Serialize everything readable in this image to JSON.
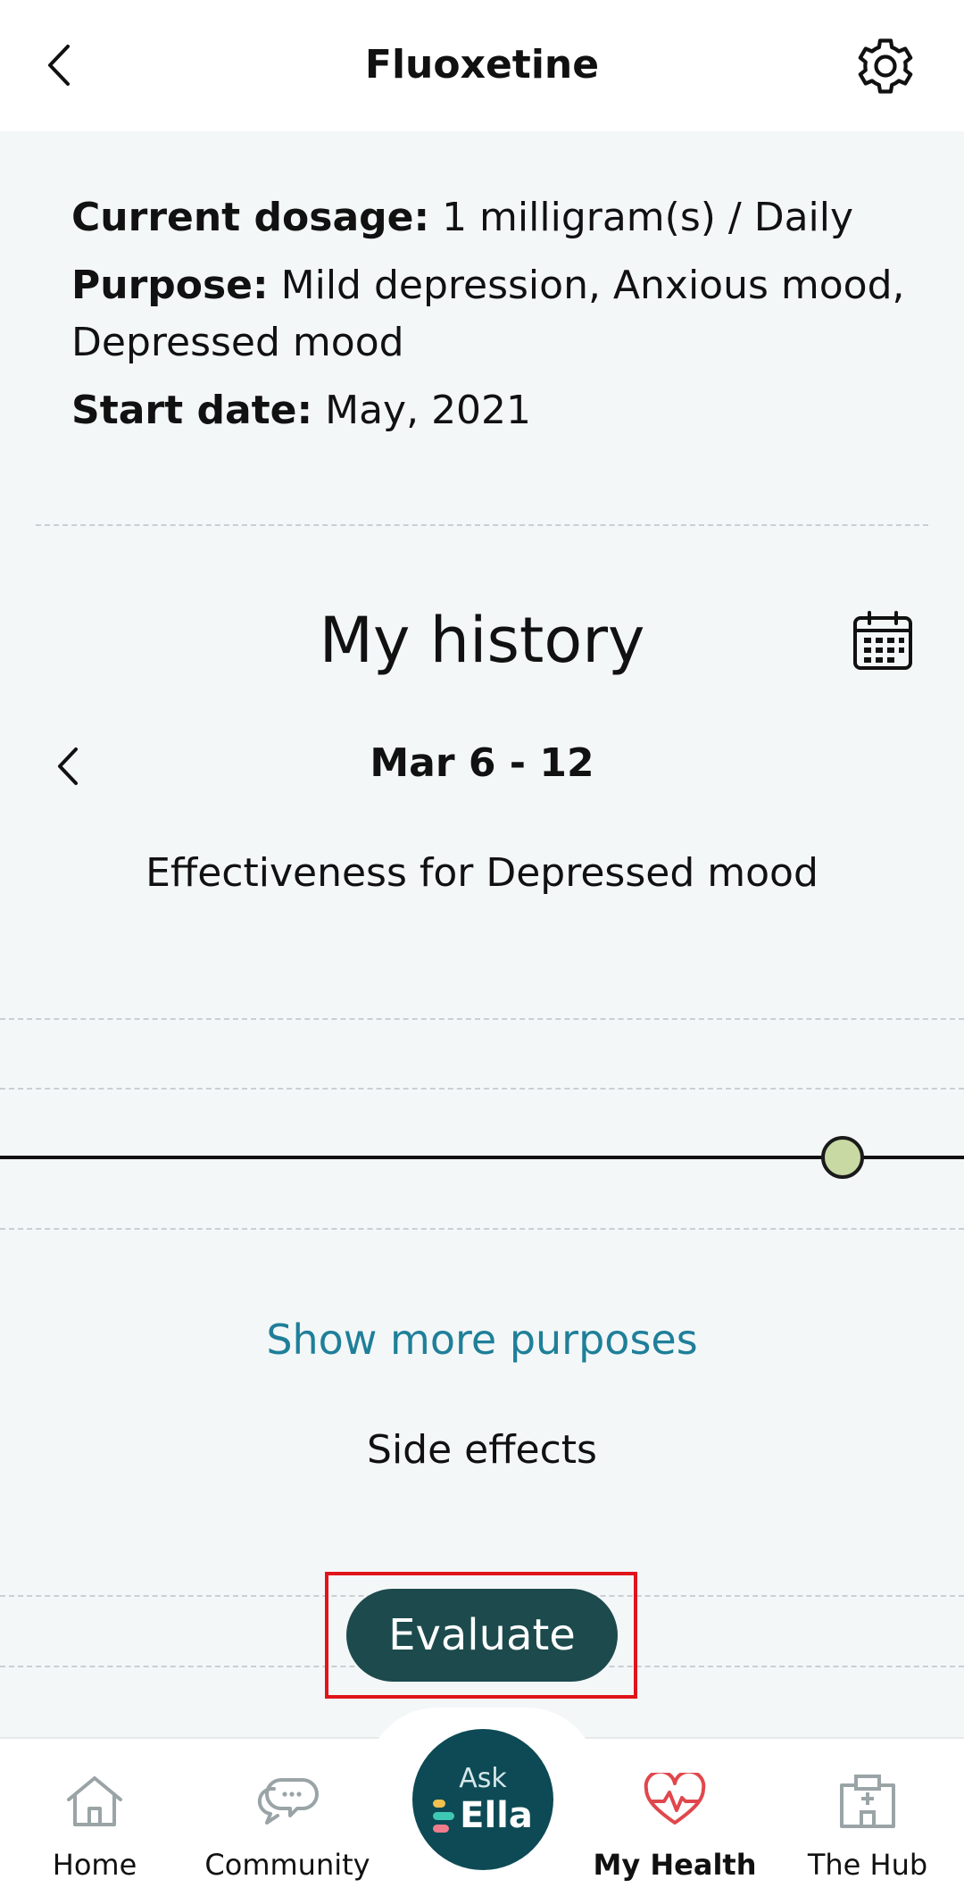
{
  "header": {
    "title": "Fluoxetine"
  },
  "info": {
    "dosage_label": "Current dosage:",
    "dosage_value": "1 milligram(s) / Daily",
    "purpose_label": "Purpose:",
    "purpose_value": "Mild depression, Anxious mood, Depressed mood",
    "start_label": "Start date:",
    "start_value": "May, 2021"
  },
  "history": {
    "title": "My history",
    "week_range": "Mar 6 - 12",
    "effectiveness_title": "Effectiveness for Depressed mood"
  },
  "links": {
    "show_more": "Show more purposes",
    "side_effects": "Side effects"
  },
  "actions": {
    "evaluate": "Evaluate"
  },
  "ask_ella": {
    "ask": "Ask",
    "ella": "Ella"
  },
  "nav": {
    "home": "Home",
    "community": "Community",
    "my_health": "My Health",
    "the_hub": "The Hub"
  },
  "colors": {
    "accent_teal": "#1c4a4d",
    "link_blue": "#1f7f99",
    "active_nav": "#e0474c",
    "highlight": "#e0141b"
  }
}
